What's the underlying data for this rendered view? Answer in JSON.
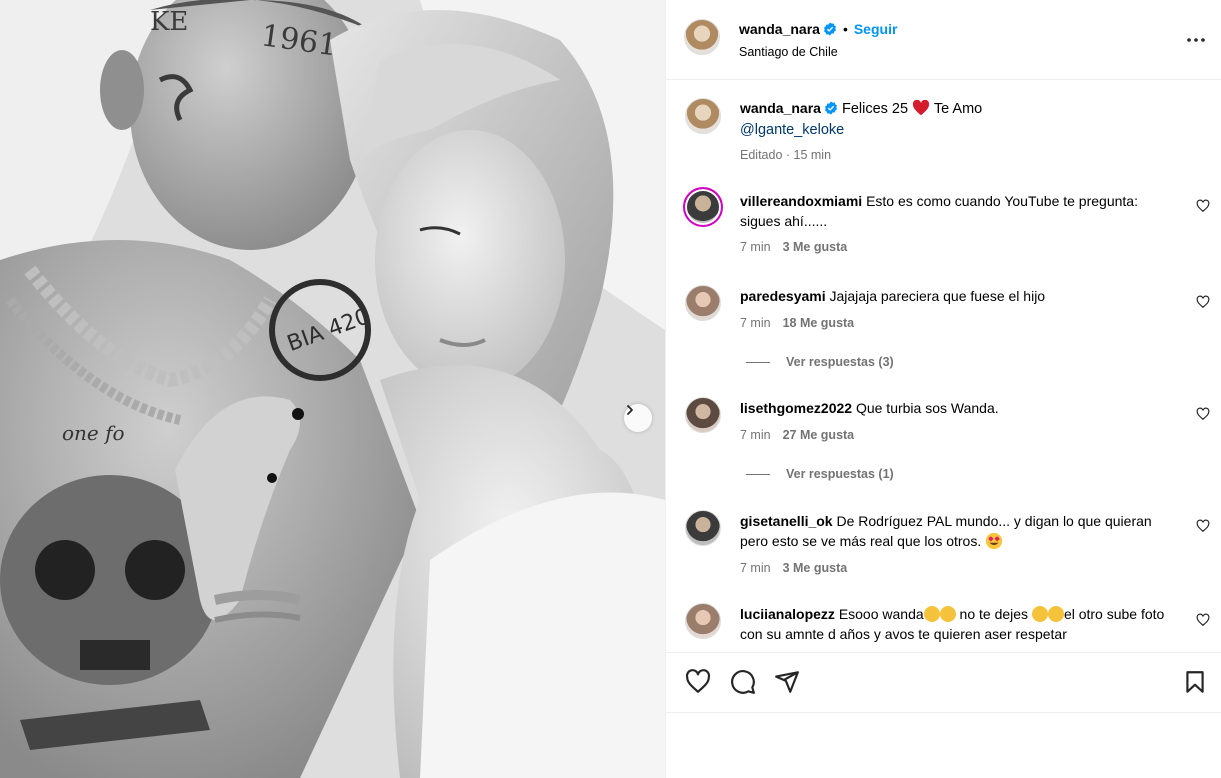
{
  "post": {
    "author": "wanda_nara",
    "location": "Santiago de Chile",
    "follow_label": "Seguir",
    "caption": "Felices 25",
    "caption_end": "Te Amo",
    "mention": "@lgante_keloke",
    "edited": "Editado · 15 min"
  },
  "comments": [
    {
      "user": "villereandoxmiami",
      "text": "Esto es como cuando YouTube te pregunta: sigues ahí......",
      "time": "7 min",
      "likes": "3 Me gusta"
    },
    {
      "user": "paredesyami",
      "text": "Jajajaja pareciera que fuese el hijo",
      "time": "7 min",
      "likes": "18 Me gusta",
      "replies": "Ver respuestas (3)"
    },
    {
      "user": "lisethgomez2022",
      "text": "Que turbia sos Wanda.",
      "time": "7 min",
      "likes": "27 Me gusta",
      "replies": "Ver respuestas (1)"
    },
    {
      "user": "gisetanelli_ok",
      "text": "De Rodríguez PAL mundo... y digan lo que quieran pero esto se ve más real que los otros.",
      "time": "7 min",
      "likes": "3 Me gusta"
    },
    {
      "user": "luciianalopezz",
      "text_a": "Esooo wanda",
      "text_b": "no te dejes",
      "text_c": "el otro sube foto con su amnte d años y avos te quieren aser respetar"
    }
  ],
  "colors": {
    "accent": "#0095f6",
    "heart": "#ed4956",
    "muted": "#737373",
    "verified": "#0095f6"
  },
  "icons": [
    "more-icon",
    "heart-icon",
    "comment-icon",
    "share-icon",
    "bookmark-icon",
    "chevron-right-icon",
    "verified-icon"
  ]
}
